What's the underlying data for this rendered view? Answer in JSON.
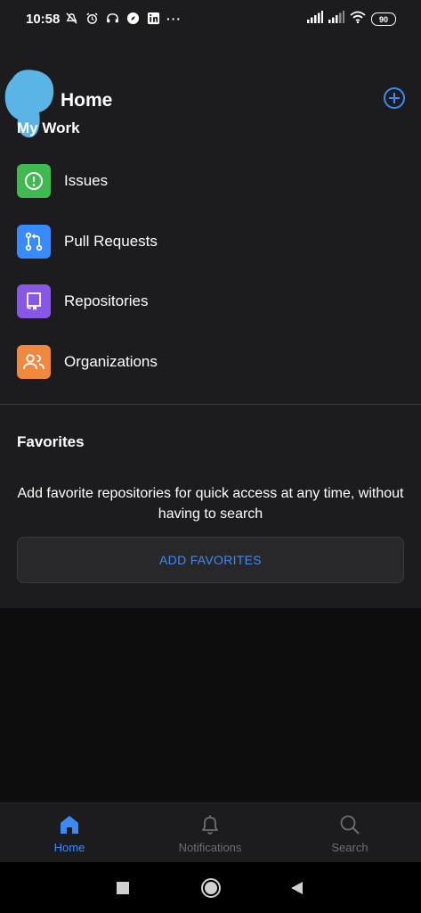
{
  "status_bar": {
    "time": "10:58",
    "battery": "90",
    "icons": [
      "mute-icon",
      "alarm-icon",
      "headphones-icon",
      "compass-icon",
      "linkedin-icon",
      "more-icon",
      "signal-icon",
      "signal-icon",
      "wifi-icon",
      "battery-icon"
    ],
    "more": "···"
  },
  "header": {
    "title": "Home",
    "add_icon": "plus-circle-icon"
  },
  "my_work": {
    "heading": "My Work",
    "items": [
      {
        "label": "Issues",
        "icon": "issue-icon",
        "color": "#3fb950"
      },
      {
        "label": "Pull Requests",
        "icon": "pull-request-icon",
        "color": "#388bfd"
      },
      {
        "label": "Repositories",
        "icon": "repo-icon",
        "color": "#8957e5"
      },
      {
        "label": "Organizations",
        "icon": "organization-icon",
        "color": "#f0883e"
      }
    ]
  },
  "favorites": {
    "heading": "Favorites",
    "description": "Add favorite repositories for quick access at any time, without having to search",
    "button_label": "ADD FAVORITES"
  },
  "tabs": [
    {
      "label": "Home",
      "icon": "home-icon",
      "active": true
    },
    {
      "label": "Notifications",
      "icon": "bell-icon",
      "active": false
    },
    {
      "label": "Search",
      "icon": "search-icon",
      "active": false
    }
  ],
  "colors": {
    "accent": "#3d8bf2",
    "background": "#1c1c1e",
    "inactive_tab": "#6e6e73"
  }
}
